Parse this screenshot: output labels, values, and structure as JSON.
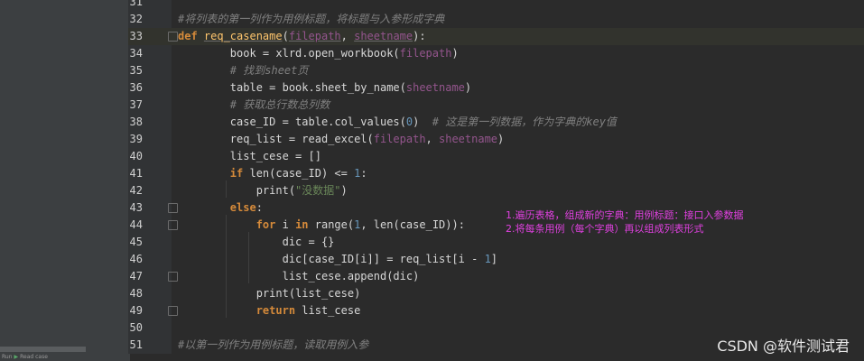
{
  "editor": {
    "lines": [
      {
        "no": "31",
        "tokens": []
      },
      {
        "no": "32",
        "tokens": [
          {
            "t": "#将列表的第一列作为用例标题，将标题与入参形成字典",
            "c": "cm"
          }
        ]
      },
      {
        "no": "33",
        "tokens": [
          {
            "t": "def ",
            "c": "kw"
          },
          {
            "t": "req_casename",
            "c": "fn"
          },
          {
            "t": "(",
            "c": ""
          },
          {
            "t": "filepath",
            "c": "param"
          },
          {
            "t": ", ",
            "c": ""
          },
          {
            "t": "sheetname",
            "c": "param"
          },
          {
            "t": "):",
            "c": ""
          }
        ]
      },
      {
        "no": "34",
        "tokens": [
          {
            "t": "        book = xlrd.open_workbook(",
            "c": ""
          },
          {
            "t": "filepath",
            "c": "param-plain"
          },
          {
            "t": ")",
            "c": ""
          }
        ]
      },
      {
        "no": "35",
        "tokens": [
          {
            "t": "        # 找到sheet页",
            "c": "cm"
          }
        ]
      },
      {
        "no": "36",
        "tokens": [
          {
            "t": "        table = book.sheet_by_name(",
            "c": ""
          },
          {
            "t": "sheetname",
            "c": "param-plain"
          },
          {
            "t": ")",
            "c": ""
          }
        ]
      },
      {
        "no": "37",
        "tokens": [
          {
            "t": "        # 获取总行数总列数",
            "c": "cm"
          }
        ]
      },
      {
        "no": "38",
        "tokens": [
          {
            "t": "        case_ID = table.col_values(",
            "c": ""
          },
          {
            "t": "0",
            "c": "num"
          },
          {
            "t": ")  ",
            "c": ""
          },
          {
            "t": "# 这是第一列数据，作为字典的key值",
            "c": "cm"
          }
        ]
      },
      {
        "no": "39",
        "tokens": [
          {
            "t": "        req_list = read_excel(",
            "c": ""
          },
          {
            "t": "filepath",
            "c": "param-plain"
          },
          {
            "t": ", ",
            "c": ""
          },
          {
            "t": "sheetname",
            "c": "param-plain"
          },
          {
            "t": ")",
            "c": ""
          }
        ]
      },
      {
        "no": "40",
        "tokens": [
          {
            "t": "        list_cese = []",
            "c": ""
          }
        ]
      },
      {
        "no": "41",
        "tokens": [
          {
            "t": "        ",
            "c": ""
          },
          {
            "t": "if ",
            "c": "kw"
          },
          {
            "t": "len(case_ID) <= ",
            "c": ""
          },
          {
            "t": "1",
            "c": "num"
          },
          {
            "t": ":",
            "c": ""
          }
        ]
      },
      {
        "no": "42",
        "tokens": [
          {
            "t": "            print(",
            "c": ""
          },
          {
            "t": "\"没数据\"",
            "c": "str"
          },
          {
            "t": ")",
            "c": ""
          }
        ]
      },
      {
        "no": "43",
        "tokens": [
          {
            "t": "        ",
            "c": ""
          },
          {
            "t": "else",
            "c": "kw"
          },
          {
            "t": ":",
            "c": ""
          }
        ]
      },
      {
        "no": "44",
        "tokens": [
          {
            "t": "            ",
            "c": ""
          },
          {
            "t": "for ",
            "c": "kw"
          },
          {
            "t": "i ",
            "c": ""
          },
          {
            "t": "in ",
            "c": "kw"
          },
          {
            "t": "range(",
            "c": ""
          },
          {
            "t": "1",
            "c": "num"
          },
          {
            "t": ", len(case_ID)):",
            "c": ""
          }
        ]
      },
      {
        "no": "45",
        "tokens": [
          {
            "t": "                dic = {}",
            "c": ""
          }
        ]
      },
      {
        "no": "46",
        "tokens": [
          {
            "t": "                dic[case_ID[i]] = req_list[i - ",
            "c": ""
          },
          {
            "t": "1",
            "c": "num"
          },
          {
            "t": "]",
            "c": ""
          }
        ]
      },
      {
        "no": "47",
        "tokens": [
          {
            "t": "                list_cese.append(dic)",
            "c": ""
          }
        ]
      },
      {
        "no": "48",
        "tokens": [
          {
            "t": "            print(list_cese)",
            "c": ""
          }
        ]
      },
      {
        "no": "49",
        "tokens": [
          {
            "t": "            ",
            "c": ""
          },
          {
            "t": "return ",
            "c": "kw"
          },
          {
            "t": "list_cese",
            "c": ""
          }
        ]
      },
      {
        "no": "50",
        "tokens": []
      },
      {
        "no": "51",
        "tokens": [
          {
            "t": "#以第一列作为用例标题，读取用例入参",
            "c": "cm"
          }
        ]
      }
    ]
  },
  "annotations": [
    "1.遍历表格，组成新的字典：用例标题：接口入参数据",
    "2.将每条用例（每个字典）再以组成列表形式"
  ],
  "watermark": "CSDN @软件测试君",
  "statusbar": {
    "run_label": "Run",
    "file_label": "Read case"
  },
  "colors": {
    "keyword": "#d58a3a",
    "function": "#ffc66d",
    "parameter": "#94558d",
    "comment": "#808080",
    "number": "#6897bb",
    "string": "#6a8759",
    "annotation": "#e040e0"
  }
}
